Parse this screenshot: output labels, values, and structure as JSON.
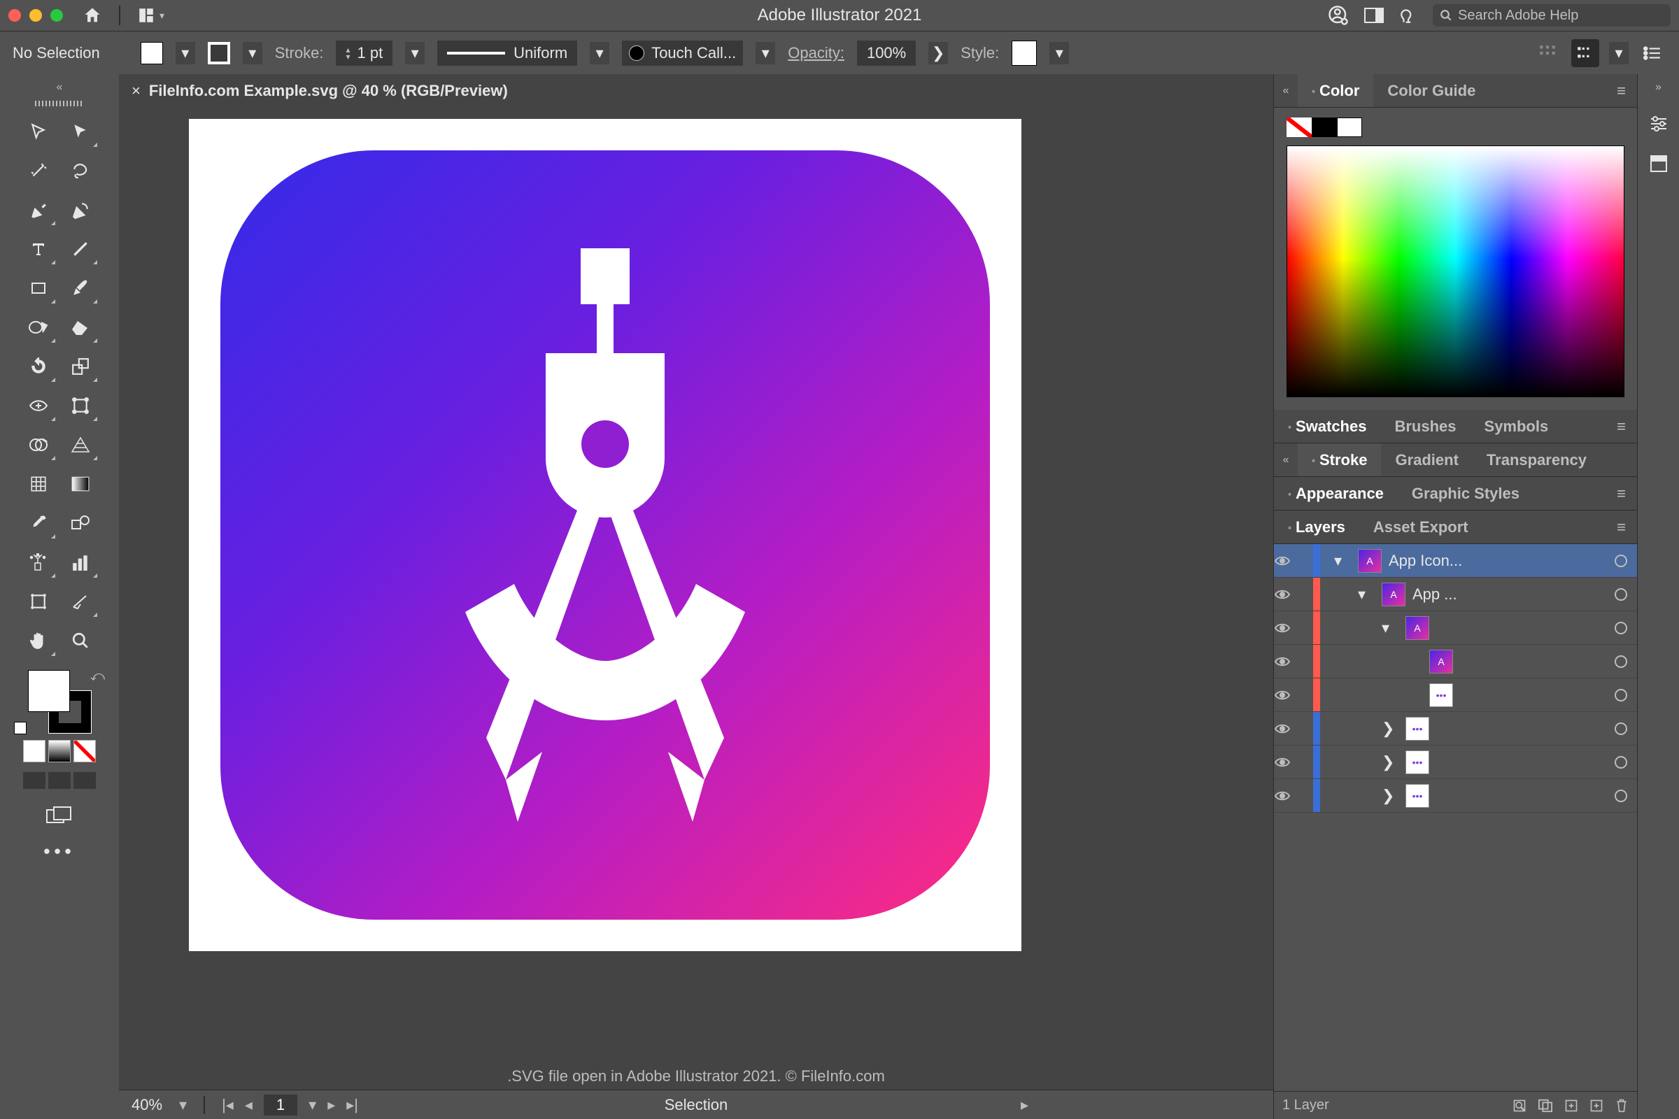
{
  "titlebar": {
    "app_title": "Adobe Illustrator 2021",
    "search_placeholder": "Search Adobe Help"
  },
  "controlbar": {
    "selection_state": "No Selection",
    "stroke_label": "Stroke:",
    "stroke_value": "1 pt",
    "brush_profile": "Uniform",
    "brush_name": "Touch Call...",
    "opacity_label": "Opacity:",
    "opacity_value": "100%",
    "style_label": "Style:"
  },
  "document": {
    "tab_title": "FileInfo.com Example.svg @ 40 % (RGB/Preview)",
    "zoom": "40%",
    "artboard_page": "1",
    "selection_status": "Selection",
    "caption": ".SVG file open in Adobe Illustrator 2021. © FileInfo.com",
    "layer_count_label": "1 Layer"
  },
  "panels": {
    "color_tabs": [
      "Color",
      "Color Guide"
    ],
    "swatch_tabs": [
      "Swatches",
      "Brushes",
      "Symbols"
    ],
    "stroke_tabs": [
      "Stroke",
      "Gradient",
      "Transparency"
    ],
    "appearance_tabs": [
      "Appearance",
      "Graphic Styles"
    ],
    "layer_tabs": [
      "Layers",
      "Asset Export"
    ]
  },
  "layers": [
    {
      "name": "App Icon...",
      "indent": 0,
      "edge": "#3a6fd8",
      "sel": true,
      "arrow": "down",
      "thumb": "grad"
    },
    {
      "name": "App ...",
      "indent": 1,
      "edge": "#ff5a4d",
      "arrow": "down",
      "thumb": "grad"
    },
    {
      "name": "",
      "indent": 2,
      "edge": "#ff5a4d",
      "arrow": "down",
      "thumb": "grad"
    },
    {
      "name": "",
      "indent": 3,
      "edge": "#ff5a4d",
      "arrow": "",
      "thumb": "grad"
    },
    {
      "name": "",
      "indent": 3,
      "edge": "#ff5a4d",
      "arrow": "",
      "thumb": "wht"
    },
    {
      "name": "",
      "indent": 2,
      "edge": "#3a6fd8",
      "arrow": "right",
      "thumb": "wht"
    },
    {
      "name": "",
      "indent": 2,
      "edge": "#3a6fd8",
      "arrow": "right",
      "thumb": "wht"
    },
    {
      "name": "",
      "indent": 2,
      "edge": "#3a6fd8",
      "arrow": "right",
      "thumb": "wht"
    }
  ],
  "artwork": {
    "gradient_start": "#332be8",
    "gradient_end": "#ff2c80",
    "glyph": "compass"
  }
}
